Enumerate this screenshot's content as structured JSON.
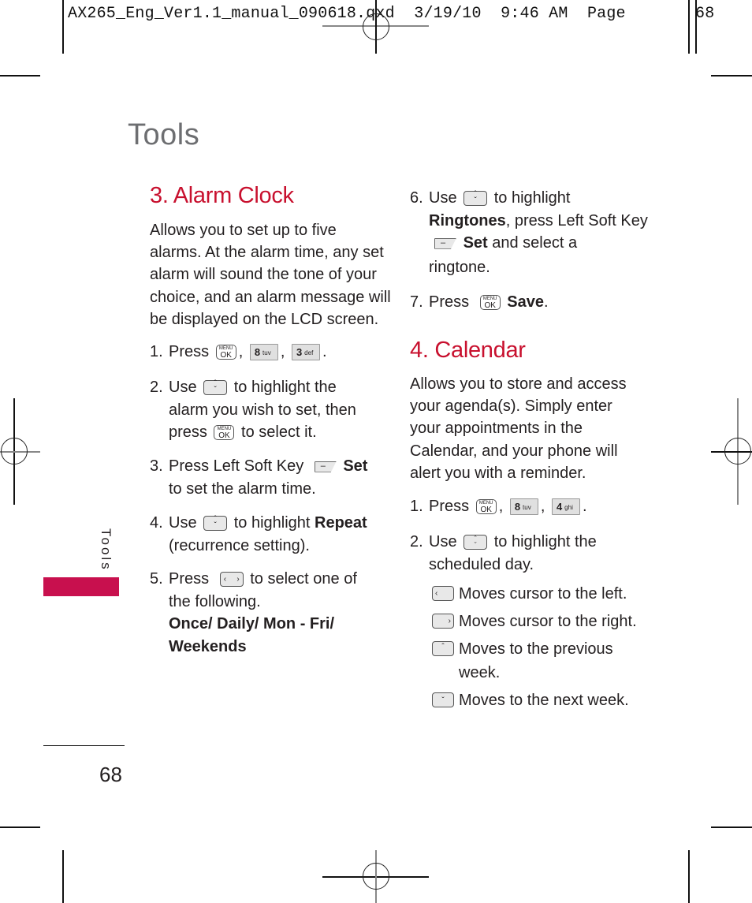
{
  "slug": {
    "filename": "AX265_Eng_Ver1.1_manual_090618.qxd",
    "date": "3/19/10",
    "time": "9:46 AM",
    "page_label": "Page",
    "page_number": "68"
  },
  "page_title": "Tools",
  "side_tab": {
    "label": "Tools",
    "color": "#c8104e"
  },
  "page_number": "68",
  "keys": {
    "menu_top": "MENU",
    "menu_ok": "OK",
    "key8": "8",
    "key8_letters": "tuv",
    "key3": "3",
    "key3_letters": "def",
    "key4": "4",
    "key4_letters": "ghi",
    "up": "ˆ",
    "down": "ˇ",
    "left": "‹",
    "right": "›",
    "soft": "–"
  },
  "alarm_clock": {
    "heading": "3. Alarm Clock",
    "intro": [
      "Allows you to set up to five",
      "alarms. At the alarm time, any set",
      "alarm will sound the tone of your",
      "choice, and an alarm message will",
      "be displayed on the LCD screen."
    ],
    "steps": [
      {
        "num": "1.",
        "pre": "Press",
        "sep1": ",",
        "sep2": ",",
        "end": "."
      },
      {
        "num": "2.",
        "pre": "Use",
        "post": "to highlight the",
        "line2": "alarm you wish to set, then",
        "line3_pre": "press",
        "line3_post": "to select it."
      },
      {
        "num": "3.",
        "pre": "Press Left Soft Key",
        "bold": "Set",
        "line2": "to set the alarm time."
      },
      {
        "num": "4.",
        "pre": "Use",
        "post": "to highlight",
        "bold": "Repeat",
        "line2": "(recurrence setting)."
      },
      {
        "num": "5.",
        "pre": "Press",
        "post": "to select one of",
        "line2": "the following.",
        "options_line1": "Once/ Daily/ Mon - Fri/",
        "options_line2": "Weekends"
      },
      {
        "num": "6.",
        "pre": "Use",
        "post": "to highlight",
        "bold_ringtones": "Ringtones",
        "line2_post": ", press Left Soft Key",
        "bold_set": "Set",
        "line3_post": "and select a",
        "line4": "ringtone."
      },
      {
        "num": "7.",
        "pre": "Press",
        "bold": "Save",
        "end": "."
      }
    ]
  },
  "calendar": {
    "heading": "4. Calendar",
    "intro": [
      "Allows you to store and access",
      "your agenda(s). Simply enter",
      "your appointments in the",
      "Calendar, and your phone will",
      "alert you with a reminder."
    ],
    "steps": [
      {
        "num": "1.",
        "pre": "Press",
        "sep1": ",",
        "sep2": ",",
        "end": "."
      },
      {
        "num": "2.",
        "pre": "Use",
        "post": "to highlight the",
        "line2": "scheduled day."
      }
    ],
    "nav_items": [
      {
        "icon": "left-key-icon",
        "text": "Moves cursor to the left."
      },
      {
        "icon": "right-key-icon",
        "text": "Moves cursor to the right."
      },
      {
        "icon": "up-key-icon",
        "text": "Moves to the previous",
        "text2": "week."
      },
      {
        "icon": "down-key-icon",
        "text": "Moves to the next week."
      }
    ]
  },
  "colors": {
    "heading": "#c8102e",
    "title": "#6d6e71",
    "text": "#231f20"
  }
}
